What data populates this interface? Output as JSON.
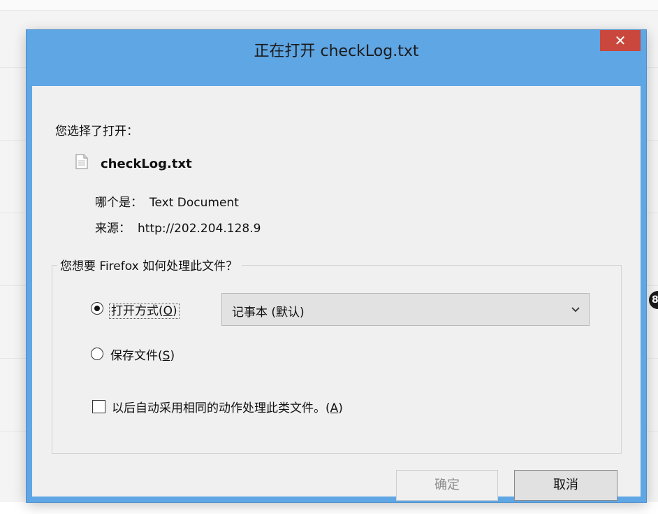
{
  "dialog": {
    "title": "正在打开 checkLog.txt",
    "close_glyph": "✕",
    "prompt": "您选择了打开：",
    "file": {
      "name": "checkLog.txt",
      "type_label": "哪个是：",
      "type_value": "Text Document",
      "source_label": "来源：",
      "source_value": "http://202.204.128.9"
    },
    "question": "您想要 Firefox 如何处理此文件？",
    "open_with": {
      "label_prefix": "打开方式(",
      "accel": "O",
      "label_suffix": ")",
      "selected": true,
      "app": "记事本 (默认)"
    },
    "save_file": {
      "label_prefix": "保存文件(",
      "accel": "S",
      "label_suffix": ")",
      "selected": false
    },
    "remember": {
      "label_prefix": "以后自动采用相同的动作处理此类文件。(",
      "accel": "A",
      "label_suffix": ")",
      "checked": false
    },
    "ok_label": "确定",
    "cancel_label": "取消"
  },
  "colors": {
    "frame": "#5fa6e4",
    "close": "#c9473d",
    "client": "#f0f0f0"
  },
  "icons": [
    "file-icon",
    "close-icon",
    "chevron-down-icon"
  ]
}
